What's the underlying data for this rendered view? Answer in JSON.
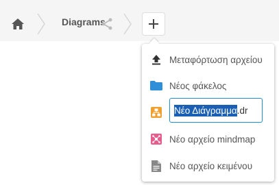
{
  "breadcrumb": {
    "home_icon": "home-icon",
    "folder": "Diagrams",
    "share_icon": "share-icon"
  },
  "toolbar": {
    "add_icon": "plus-icon"
  },
  "menu": {
    "items": [
      {
        "label": "Μεταφόρτωση αρχείου",
        "icon": "upload-icon"
      },
      {
        "label": "Νέος φάκελος",
        "icon": "folder-icon"
      },
      {
        "label": "",
        "icon": "drawio-icon"
      },
      {
        "label": "Νέο αρχείο mindmap",
        "icon": "mindmap-icon"
      },
      {
        "label": "Νέο αρχείο κειμένου",
        "icon": "text-file-icon"
      }
    ],
    "name_input": {
      "selected": "Νέο Διάγραμμα",
      "rest": ".dr"
    }
  },
  "colors": {
    "selection": "#1a5fb4",
    "input_border": "#1d8fd8",
    "folder": "#2f8fd8",
    "drawio": "#f0a030",
    "mindmap": "#e65c8c"
  }
}
